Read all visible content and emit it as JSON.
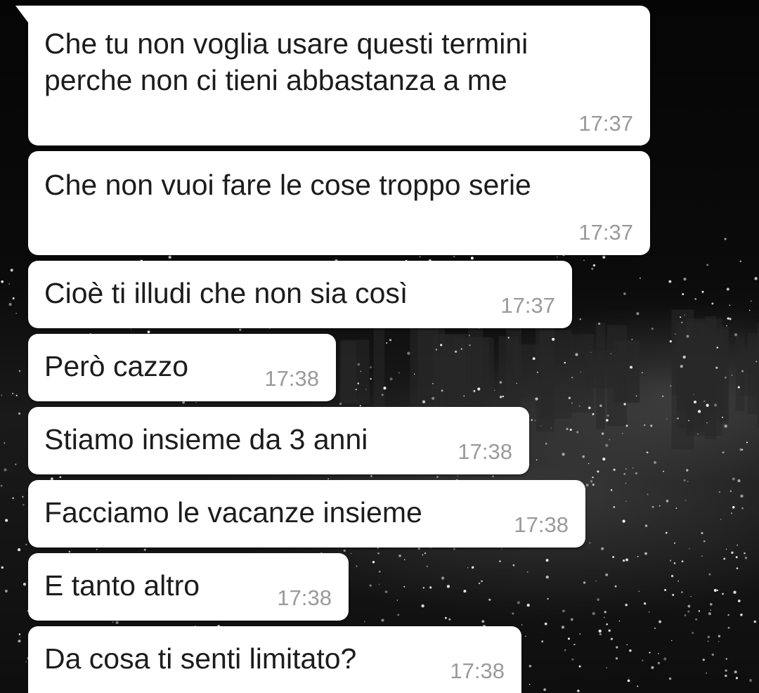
{
  "wallpaper": {
    "description_icon": "city-night-wallpaper",
    "bubble_color": "#ffffff",
    "text_color": "#1c1c1c",
    "time_color": "#9a9a9a"
  },
  "messages": [
    {
      "text_lines": [
        "Che tu non voglia usare questi termini",
        "perche non ci tieni abbastanza a me"
      ],
      "time": "17:37"
    },
    {
      "text_lines": [
        "Che non vuoi fare le cose troppo serie"
      ],
      "time": "17:37"
    },
    {
      "text_lines": [
        "Cioè ti illudi che non sia così"
      ],
      "time": "17:37"
    },
    {
      "text_lines": [
        "Però cazzo"
      ],
      "time": "17:38"
    },
    {
      "text_lines": [
        "Stiamo insieme da 3 anni"
      ],
      "time": "17:38"
    },
    {
      "text_lines": [
        "Facciamo le vacanze insieme"
      ],
      "time": "17:38"
    },
    {
      "text_lines": [
        "E tanto altro"
      ],
      "time": "17:38"
    },
    {
      "text_lines": [
        "Da cosa ti senti limitato?"
      ],
      "time": "17:38"
    }
  ]
}
